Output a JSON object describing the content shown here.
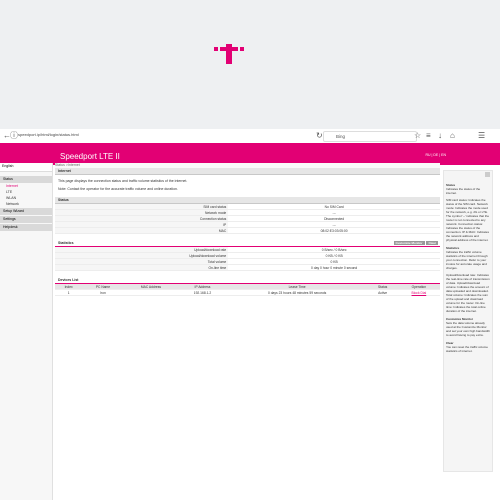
{
  "browser": {
    "url": "speedport.ip/html/login/status.html",
    "search_placeholder": "Bing"
  },
  "header": {
    "brand": "Speedport LTE II",
    "links": "RU | DE | EN"
  },
  "sidebar": {
    "language": "English",
    "items": [
      {
        "label": "Status",
        "type": "header"
      },
      {
        "label": "Internet",
        "type": "item",
        "active": true
      },
      {
        "label": "LTE",
        "type": "item"
      },
      {
        "label": "WLAN",
        "type": "item"
      },
      {
        "label": "Network",
        "type": "item"
      },
      {
        "label": "Setup Wizard",
        "type": "main"
      },
      {
        "label": "Settings",
        "type": "main"
      },
      {
        "label": "Helpdesk",
        "type": "main"
      }
    ]
  },
  "breadcrumb": "Status >Internet",
  "main": {
    "section_title": "Internet",
    "intro": "This page displays the connection status and traffic volume statistics of the internet.",
    "note": "Note: Contact the operator for the accurate traffic volume and online duration.",
    "status": {
      "title": "Status",
      "rows": [
        {
          "label": "SIM card status",
          "value": "No SIM Card"
        },
        {
          "label": "Network mode",
          "value": "---"
        },
        {
          "label": "Connection status",
          "value": "Disconnected"
        },
        {
          "label": "IP",
          "value": "---"
        },
        {
          "label": "MAC",
          "value": "08:02:E3:03:05:00"
        }
      ]
    },
    "statistics": {
      "title": "Statistics",
      "btn_customize": "Customize Monitor",
      "btn_clear": "Clear",
      "rows": [
        {
          "label": "Upload/download rate",
          "value": "0 B/sec / 0 B/sec"
        },
        {
          "label": "Upload/download volume",
          "value": "0 KB / 0 KB"
        },
        {
          "label": "Total volume",
          "value": "0 KB"
        },
        {
          "label": "On-line time",
          "value": "0 day 0 hour 0 minute 0 second"
        }
      ]
    },
    "devices": {
      "title": "Devices List",
      "columns": [
        "Index",
        "PC Name",
        "MAC Address",
        "IP Address",
        "Lease Time",
        "Status",
        "Operation"
      ],
      "rows": [
        {
          "index": "1",
          "pc_name": "Iron",
          "mac": "",
          "ip": "192.168.1.2",
          "lease": "0 days 23 hours 48 minutes 59 seconds",
          "status": "Active",
          "operation": "Block Dial"
        }
      ]
    }
  },
  "help": {
    "title": "Status",
    "sections": [
      {
        "title": "",
        "text": "Indicates the status of the internet."
      },
      {
        "title": "",
        "text": "SIM card status: Indicates the status of the SIM card. Network mode: Indicates the mode used for the network, e.g. 2G or LTE. The symbol '--' indicates that the router is not connected to any network. Connection status: Indicates the status of the connection. IP & MAC: Indicates the network address and physical address of the internet."
      },
      {
        "title": "Statistics",
        "text": "Indicates the traffic volume statistics of the internet through your connection. Refer to your invoice for accurate usage and charges."
      },
      {
        "title": "",
        "text": "Upload/download rate: Indicates the real-time rate of transmission of data. Upload/download volume: Indicates the amount of data uploaded and downloaded. Total volume: Indicates the sum of the upload and download volume for the router. On-line time: Indicates the total online duration of the internet."
      },
      {
        "title": "Customize Monitor",
        "text": "Sets the data volume already used at the Customize Monitor and set your own high bandwidth to avoid having to pay extra."
      },
      {
        "title": "Clear",
        "text": "You can reset the traffic volume statistics of internet."
      }
    ]
  },
  "colors": {
    "brand": "#e20074",
    "panel": "#e6e6e6"
  }
}
